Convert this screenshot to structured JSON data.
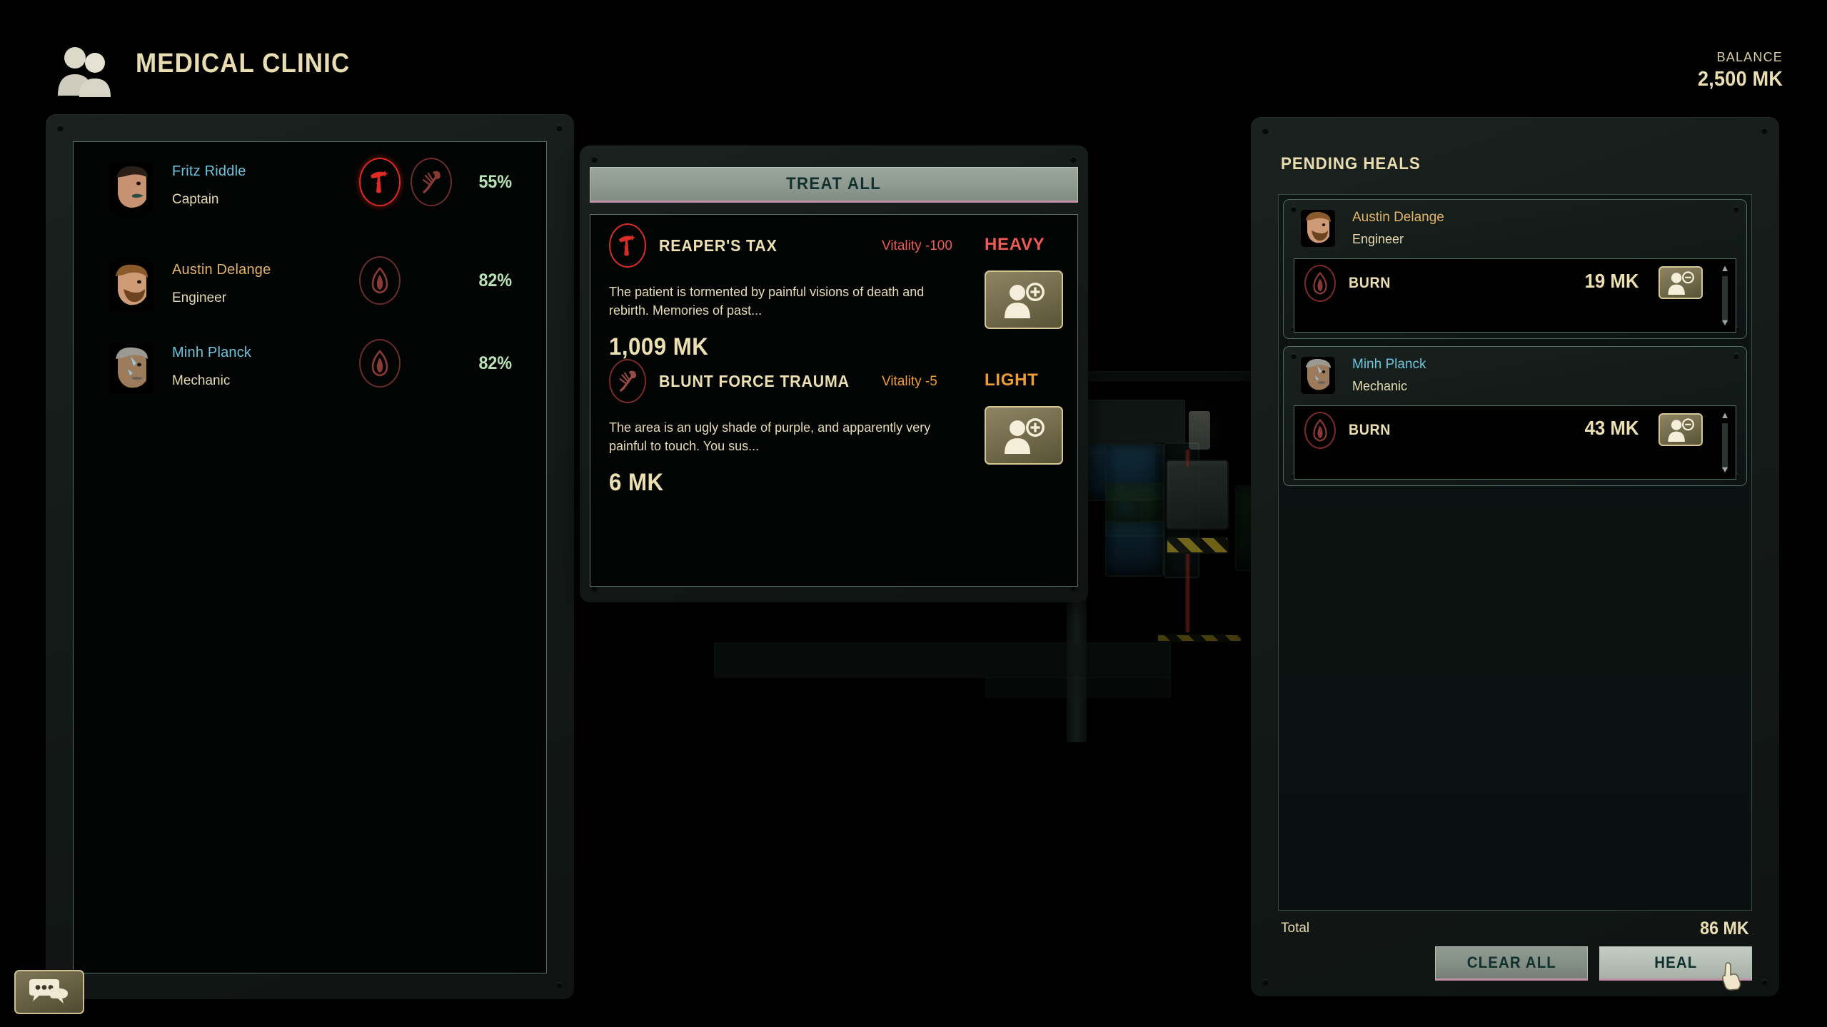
{
  "header": {
    "title": "MEDICAL CLINIC",
    "icon": "two-people-icon",
    "balance_label": "BALANCE",
    "balance_value": "2,500 MK"
  },
  "crew_panel": {
    "name": "crew-roster",
    "members": [
      {
        "name": "Fritz Riddle",
        "role": "Captain",
        "health": "55%",
        "name_color": "#6fc3dd",
        "ailments": [
          {
            "icon": "reapers-tax-icon",
            "active": true
          },
          {
            "icon": "blunt-force-trauma-icon",
            "active": false
          }
        ]
      },
      {
        "name": "Austin Delange",
        "role": "Engineer",
        "health": "82%",
        "name_color": "#e2b466",
        "ailments": [
          {
            "icon": "burn-icon",
            "active": false
          }
        ]
      },
      {
        "name": "Minh Planck",
        "role": "Mechanic",
        "health": "82%",
        "name_color": "#6fc3dd",
        "ailments": [
          {
            "icon": "burn-icon",
            "active": false
          }
        ]
      }
    ]
  },
  "treatment_panel": {
    "treat_all_label": "TREAT ALL",
    "afflictions": [
      {
        "icon": "reapers-tax-icon",
        "name": "REAPER'S TAX",
        "vitality": "Vitality -100",
        "severity": "HEAVY",
        "severity_color": "#ee5a54",
        "description": "The patient is tormented by painful visions of death and rebirth. Memories of past...",
        "price": "1,009 MK",
        "action_icon": "add-patient-icon"
      },
      {
        "icon": "blunt-force-trauma-icon",
        "name": "BLUNT FORCE TRAUMA",
        "vitality": "Vitality -5",
        "severity": "LIGHT",
        "severity_color": "#ef9c33",
        "description": "The area is an ugly shade of purple, and apparently very painful to touch. You sus...",
        "price": "6 MK",
        "action_icon": "add-patient-icon"
      }
    ]
  },
  "pending_panel": {
    "title": "PENDING HEALS",
    "cards": [
      {
        "name": "Austin Delange",
        "role": "Engineer",
        "name_color": "#e2b466",
        "heal": {
          "icon": "burn-icon",
          "name": "BURN",
          "price": "19 MK",
          "action_icon": "remove-patient-icon"
        }
      },
      {
        "name": "Minh Planck",
        "role": "Mechanic",
        "name_color": "#6fc3dd",
        "heal": {
          "icon": "burn-icon",
          "name": "BURN",
          "price": "43 MK",
          "action_icon": "remove-patient-icon"
        }
      }
    ],
    "total_label": "Total",
    "total_value": "86 MK",
    "clear_all_label": "CLEAR ALL",
    "heal_label": "HEAL"
  },
  "chat_button": {
    "icon": "chat-bubbles-icon"
  },
  "cursor": {
    "icon": "pointing-hand-cursor"
  }
}
